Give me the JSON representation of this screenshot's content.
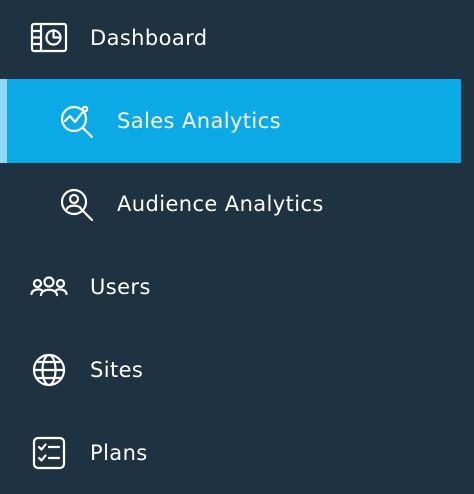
{
  "sidebar": {
    "items": [
      {
        "label": "Dashboard",
        "icon": "dashboard-icon"
      },
      {
        "label": "Sales Analytics",
        "icon": "sales-analytics-icon",
        "active": true
      },
      {
        "label": "Audience Analytics",
        "icon": "audience-analytics-icon"
      },
      {
        "label": "Users",
        "icon": "users-icon"
      },
      {
        "label": "Sites",
        "icon": "globe-icon"
      },
      {
        "label": "Plans",
        "icon": "checklist-icon"
      }
    ]
  },
  "colors": {
    "background": "#1f3242",
    "active": "#0ca9e7",
    "active_edge": "#8fd9f7",
    "text": "#ffffff"
  }
}
